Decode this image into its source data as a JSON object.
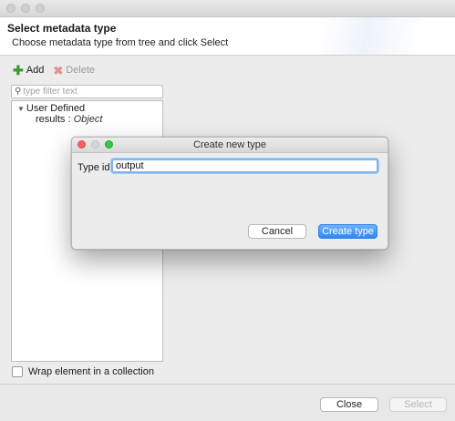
{
  "header": {
    "title": "Select metadata type",
    "description": "Choose metadata type from tree and click Select"
  },
  "toolbar": {
    "add_label": "Add",
    "delete_label": "Delete"
  },
  "filter": {
    "placeholder": "type filter text"
  },
  "tree": {
    "root_label": "User Defined",
    "children": [
      {
        "name": "results :",
        "type": "Object"
      }
    ]
  },
  "wrap_checkbox": {
    "label": "Wrap element in a collection",
    "checked": false
  },
  "footer": {
    "close_label": "Close",
    "select_label": "Select"
  },
  "dialog": {
    "title": "Create new type",
    "type_id_label": "Type id:",
    "type_id_value": "output",
    "cancel_label": "Cancel",
    "create_label": "Create type",
    "traffic_colors": {
      "close": "#fc605c",
      "minimize": "#d6d6d6",
      "zoom": "#34c84a"
    }
  }
}
